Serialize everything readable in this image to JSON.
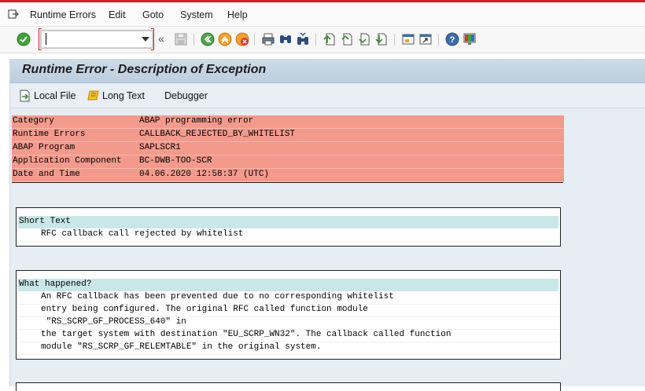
{
  "menubar": {
    "items": [
      {
        "label": "Runtime Errors"
      },
      {
        "label": "Edit"
      },
      {
        "label": "Goto"
      },
      {
        "label": "System"
      },
      {
        "label": "Help"
      }
    ]
  },
  "toolbar": {
    "command_value": "",
    "chevron": "«"
  },
  "screen": {
    "title": "Runtime Error - Description of Exception",
    "buttons": {
      "local_file": "Local File",
      "long_text": "Long Text",
      "debugger": "Debugger"
    }
  },
  "header_fields": [
    {
      "key": "Category",
      "value": "ABAP programming error"
    },
    {
      "key": "Runtime Errors",
      "value": "CALLBACK_REJECTED_BY_WHITELIST"
    },
    {
      "key": "ABAP Program",
      "value": "SAPLSCR1"
    },
    {
      "key": "Application Component",
      "value": "BC-DWB-TOO-SCR"
    },
    {
      "key": "Date and Time",
      "value": "04.06.2020 12:58:37 (UTC)"
    }
  ],
  "short_text": {
    "heading": "Short Text",
    "lines": [
      "RFC callback call rejected by whitelist"
    ]
  },
  "what_happened": {
    "heading": "What happened?",
    "lines": [
      "An RFC callback has been prevented due to no corresponding whitelist",
      "entry being configured. The original RFC called function module",
      " \"RS_SCRP_GF_PROCESS_640\" in",
      "the target system with destination \"EU_SCRP_WN32\". The callback called function",
      "module \"RS_SCRP_GF_RELEMTABLE\" in the original system."
    ]
  },
  "colors": {
    "header_bg": "#f39a8d",
    "section_head_bg": "#c9e7e8",
    "screen_bg": "#e6edf3"
  }
}
